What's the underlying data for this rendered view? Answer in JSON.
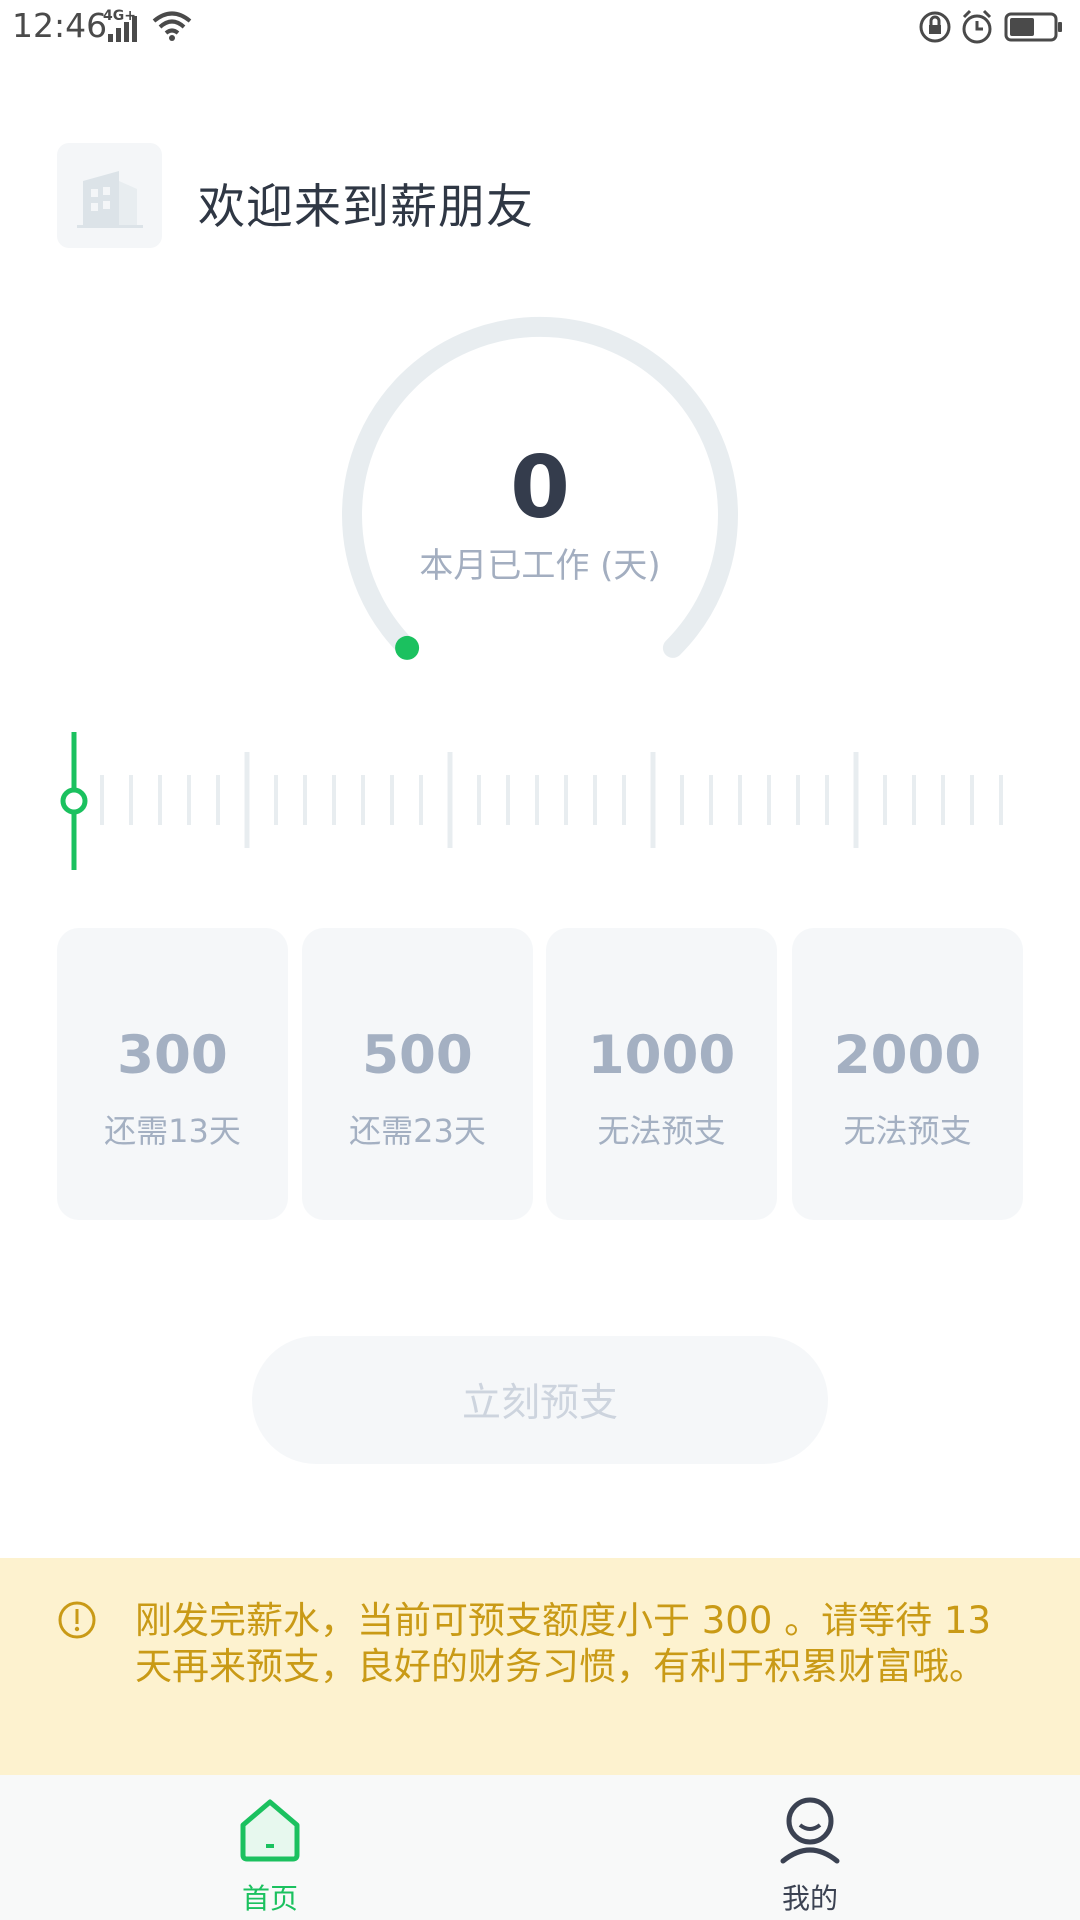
{
  "status_bar": {
    "time": "12:46",
    "signal": "4G+"
  },
  "header": {
    "welcome": "欢迎来到薪朋友"
  },
  "gauge": {
    "value": "0",
    "label": "本月已工作 (天)",
    "progress": 0
  },
  "ruler": {
    "current_position": 0
  },
  "advance_options": [
    {
      "amount": "300",
      "note": "还需13天"
    },
    {
      "amount": "500",
      "note": "还需23天"
    },
    {
      "amount": "1000",
      "note": "无法预支"
    },
    {
      "amount": "2000",
      "note": "无法预支"
    }
  ],
  "action": {
    "advance_label": "立刻预支"
  },
  "notice": {
    "text": "刚发完薪水，当前可预支额度小于 300 。请等待 13 天再来预支，良好的财务习惯，有利于积累财富哦。"
  },
  "nav": {
    "home_label": "首页",
    "mine_label": "我的"
  },
  "colors": {
    "accent": "#1bc15f",
    "warning": "#c99a16",
    "warning_bg": "#fdf2cf",
    "track": "#e8edf0"
  },
  "icons": {
    "status": [
      "lock-rotation-icon",
      "alarm-icon",
      "battery-icon",
      "wifi-icon",
      "signal-icon"
    ],
    "logo": "building-icon",
    "notice": "info-icon",
    "nav": [
      "home-icon",
      "user-icon"
    ]
  }
}
